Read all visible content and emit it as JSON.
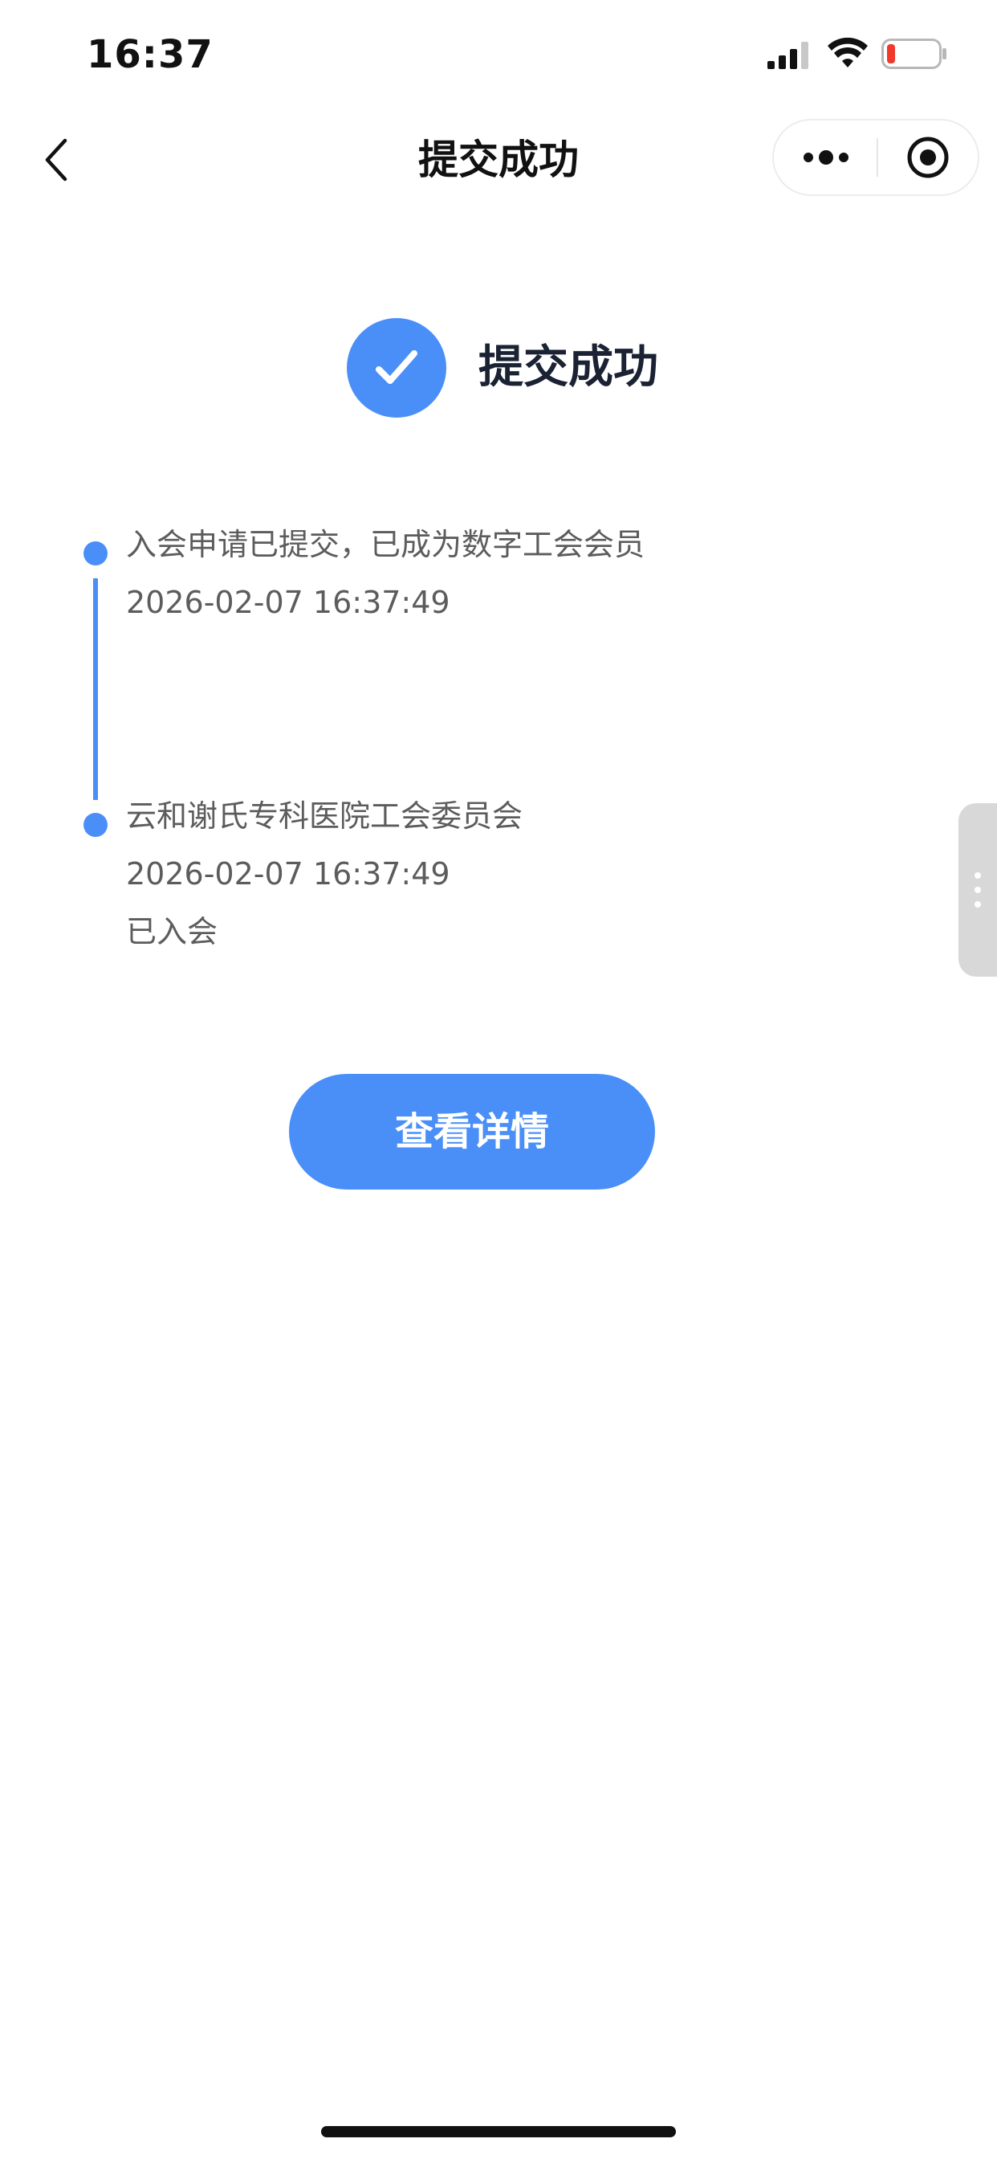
{
  "status_bar": {
    "time": "16:37"
  },
  "nav": {
    "title": "提交成功"
  },
  "success": {
    "text": "提交成功"
  },
  "timeline": [
    {
      "title": "入会申请已提交，已成为数字工会会员",
      "time": "2026-02-07 16:37:49"
    },
    {
      "title": "云和谢氏专科医院工会委员会",
      "time": "2026-02-07 16:37:49",
      "status": "已入会"
    }
  ],
  "actions": {
    "detail_label": "查看详情"
  },
  "colors": {
    "accent": "#4a8ff7",
    "battery_low": "#f03a2e"
  },
  "icons": [
    "back-chevron-icon",
    "more-icon",
    "close-target-icon",
    "check-icon",
    "signal-icon",
    "wifi-icon",
    "battery-icon"
  ]
}
